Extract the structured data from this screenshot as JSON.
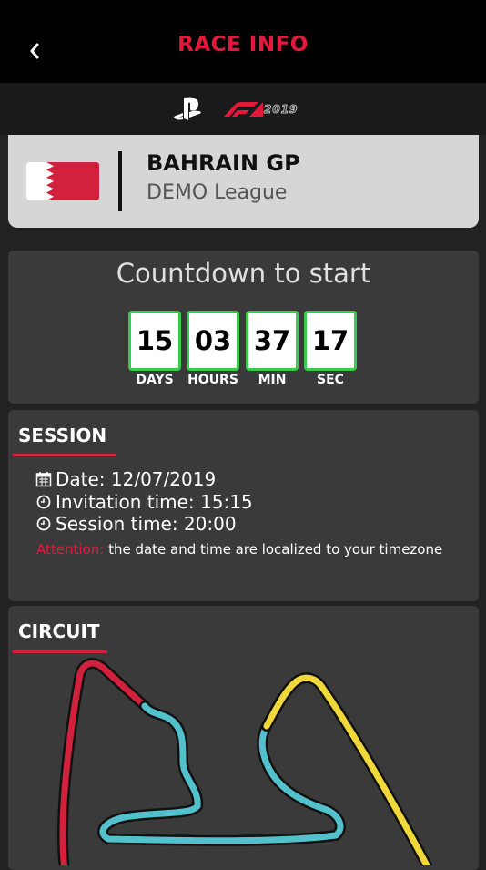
{
  "header": {
    "title": "RACE INFO"
  },
  "brand": {
    "year": "2019"
  },
  "race": {
    "name": "BAHRAIN GP",
    "league": "DEMO League"
  },
  "countdown": {
    "title": "Countdown to start",
    "units": [
      {
        "value": "15",
        "label": "DAYS"
      },
      {
        "value": "03",
        "label": "HOURS"
      },
      {
        "value": "37",
        "label": "MIN"
      },
      {
        "value": "17",
        "label": "SEC"
      }
    ]
  },
  "session": {
    "title": "SESSION",
    "date": "Date: 12/07/2019",
    "invitation_time": "Invitation time: 15:15",
    "session_time": "Session time: 20:00",
    "attention_label": "Attention:",
    "attention_text": " the date and time are localized to your timezone"
  },
  "circuit": {
    "title": "CIRCUIT"
  },
  "colors": {
    "accent": "#e3193b",
    "countdown_border": "#3ec84e",
    "track_red": "#d1213d",
    "track_blue": "#52c1cc",
    "track_yellow": "#f0d83a"
  },
  "icons": {
    "back": "chevron-left-icon",
    "date": "calendar-icon",
    "time": "clock-icon"
  }
}
